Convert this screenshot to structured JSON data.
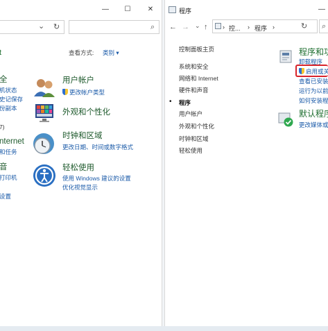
{
  "left_window": {
    "controls": {
      "minimize": "—",
      "maximize": "☐",
      "close": "✕"
    },
    "address": {
      "dropdown": "⌄",
      "refresh": "↻",
      "search_icon": "⌕"
    },
    "view_label": "查看方式:",
    "view_value": "类别 ▾",
    "left_cut": {
      "top": "t",
      "security_title": "全",
      "security_lines": [
        "机状态",
        "史记保存",
        "份副本"
      ],
      "network_line": "7)",
      "internet_title": "nternet",
      "internet_line": "和任务",
      "sound_title": "音",
      "sound_lines": [
        "打印机",
        "设置"
      ]
    },
    "categories": [
      {
        "title": "用户帐户",
        "links": [
          "更改帐户类型"
        ]
      },
      {
        "title": "外观和个性化",
        "links": []
      },
      {
        "title": "时钟和区域",
        "links": [
          "更改日期、时间或数字格式"
        ]
      },
      {
        "title": "轻松使用",
        "links": [
          "使用 Windows 建议的设置",
          "优化视觉显示"
        ]
      }
    ]
  },
  "right_window": {
    "title": "程序",
    "controls": {
      "minimize": "—"
    },
    "nav": {
      "back": "←",
      "forward": "→",
      "dropdown": "⌄",
      "up": "↑"
    },
    "breadcrumb": [
      "控...",
      "程序"
    ],
    "breadcrumb_sep": "›",
    "refresh": "↻",
    "search_glyph": "⌕",
    "sidebar": {
      "home": "控制面板主页",
      "items": [
        "系统和安全",
        "网络和 Internet",
        "硬件和声音",
        "程序",
        "用户帐户",
        "外观和个性化",
        "时钟和区域",
        "轻松使用"
      ],
      "active_index": 3,
      "active_bullet": "•"
    },
    "programs": {
      "title": "程序和功",
      "links": [
        "卸载程序",
        "启用或关",
        "查看已安装",
        "运行为以前",
        "如何安装程"
      ]
    },
    "defaults": {
      "title": "默认程序",
      "links": [
        "更改媒体或"
      ]
    }
  }
}
